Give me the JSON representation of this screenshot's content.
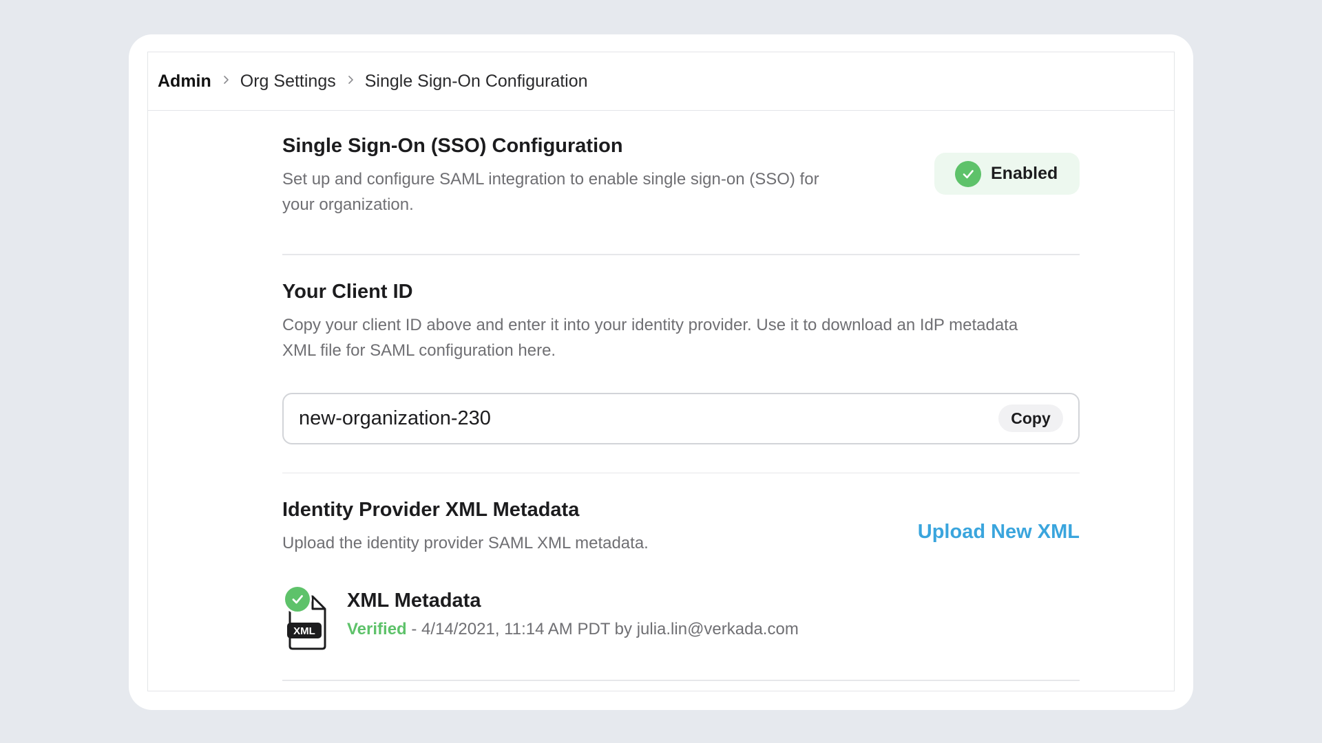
{
  "breadcrumb": {
    "items": [
      "Admin",
      "Org Settings",
      "Single Sign-On Configuration"
    ],
    "separator_icon": "chevron-right-icon"
  },
  "sso": {
    "title": "Single Sign-On (SSO) Configuration",
    "description": "Set up and configure SAML integration to enable single sign-on (SSO) for your organization.",
    "status": {
      "label": "Enabled",
      "icon": "check-circle-icon",
      "color": "#5ec26a",
      "background": "#edf8ef"
    }
  },
  "client_id": {
    "title": "Your Client ID",
    "description": "Copy your client ID above and enter it into your identity provider. Use it to download an IdP metadata XML file for SAML configuration here.",
    "value": "new-organization-230",
    "copy_label": "Copy"
  },
  "idp_xml": {
    "title": "Identity Provider XML Metadata",
    "description": "Upload the identity provider SAML XML metadata.",
    "upload_label": "Upload New XML",
    "upload_color": "#3aa5dd",
    "file": {
      "icon": "xml-file-icon",
      "icon_text": "XML",
      "title": "XML Metadata",
      "status": "Verified",
      "status_color": "#5ec26a",
      "separator": " - ",
      "details": "4/14/2021, 11:14 AM PDT by julia.lin@verkada.com"
    }
  }
}
